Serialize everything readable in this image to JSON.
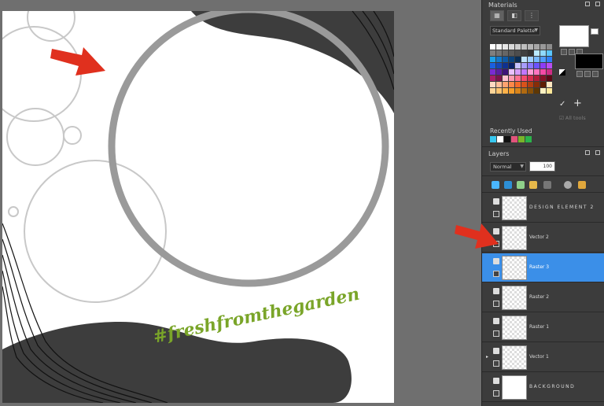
{
  "materials": {
    "title": "Materials",
    "palette_select": "Standard Palette",
    "all_tools": "All tools",
    "recent_label": "Recently Used",
    "recent_colors": [
      "#37c8f0",
      "#ffffff",
      "#111111",
      "#e1547b",
      "#79b42a",
      "#2bb34a"
    ],
    "swatches": [
      "#ffffff",
      "#f2f2f2",
      "#e6e6e6",
      "#d9d9d9",
      "#cccccc",
      "#bfbfbf",
      "#b3b3b3",
      "#a6a6a6",
      "#999999",
      "#8c8c8c",
      "#7f7f7f",
      "#737373",
      "#666666",
      "#595959",
      "#4d4d4d",
      "#404040",
      "#333333",
      "#b9e9ff",
      "#8fd9ff",
      "#5ac6ff",
      "#1ea0e8",
      "#1477c9",
      "#0f5aa6",
      "#0c437d",
      "#0a2e55",
      "#bfe3ff",
      "#9ecfff",
      "#76b8ff",
      "#4e9cff",
      "#2e7df7",
      "#1b5fe0",
      "#1446b8",
      "#0f3190",
      "#0a2168",
      "#c6c2ff",
      "#a89dff",
      "#8a78ff",
      "#6c53ff",
      "#8d3df5",
      "#b84ef2",
      "#7a2bd1",
      "#5b1ea4",
      "#3d1378",
      "#eac2ff",
      "#d69cff",
      "#c276ff",
      "#ff9ed7",
      "#ff75c1",
      "#f44aa6",
      "#d02c86",
      "#a81d69",
      "#7c134c",
      "#ffc2d0",
      "#ff99b0",
      "#ff7090",
      "#f44a6d",
      "#d62e4f",
      "#b01c39",
      "#861227",
      "#5c0a17",
      "#ffd9c2",
      "#ffbe99",
      "#ffa370",
      "#ff884a",
      "#f56a2a",
      "#d9521a",
      "#b13e10",
      "#872d08",
      "#5e1f04",
      "#ffe8c2",
      "#ffd699",
      "#ffc470",
      "#ffb24a",
      "#f59d2a",
      "#d9841a",
      "#b16a10",
      "#875008",
      "#5e3704",
      "#fff2c2",
      "#ffe899"
    ]
  },
  "layers": {
    "title": "Layers",
    "blend_mode": "Normal",
    "opacity": "100",
    "items": [
      {
        "name": "DESIGN ELEMENT 2",
        "selected": false
      },
      {
        "name": "Vector 2",
        "selected": false
      },
      {
        "name": "Raster 3",
        "selected": true
      },
      {
        "name": "Raster 2",
        "selected": false
      },
      {
        "name": "Raster 1",
        "selected": false
      },
      {
        "name": "Vector 1",
        "selected": false
      },
      {
        "name": "BACKGROUND",
        "selected": false
      }
    ]
  },
  "canvas": {
    "hashtag": "#freshfromthegarden"
  },
  "colors": {
    "accent_green": "#7aa529",
    "selection_blue": "#3b8fe8",
    "arrow_red": "#e0301e"
  }
}
